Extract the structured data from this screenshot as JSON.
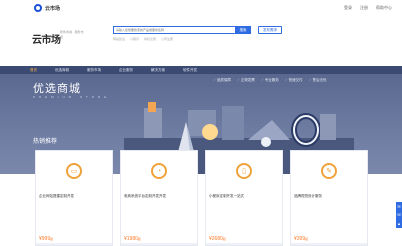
{
  "topbar": {
    "brand": "云市场",
    "links": [
      "登录",
      "注册",
      "帮助中心"
    ]
  },
  "header": {
    "logo": "云市场",
    "logo_sub": "软件商城 · 服务市场",
    "search_placeholder": "请输入您想要搜索的产品或服务名称",
    "search_button": "搜索",
    "publish_button": "发布需求",
    "hot_links": [
      "网站建设",
      "小程序",
      "商标注册",
      "公司注册"
    ]
  },
  "nav": {
    "items": [
      "首页",
      "优选商城",
      "服务市场",
      "企业服务",
      "解决方案",
      "软件开发"
    ],
    "active_index": 0
  },
  "banner": {
    "title": "优选商城",
    "subtitle": "PREMIUM STORE",
    "services": [
      "品质保障",
      "正规发票",
      "专业服务",
      "快速交付",
      "售后无忧"
    ],
    "section_title": "热销推荐"
  },
  "cards": [
    {
      "title": "企业网站搭建定制开发",
      "price": "¥999",
      "price_unit": "起",
      "icon": "monitor-icon"
    },
    {
      "title": "电商系统平台定制开发开发",
      "price": "¥1980",
      "price_unit": "起",
      "icon": "cart-icon"
    },
    {
      "title": "小程序定制开发一站式",
      "price": "¥2680",
      "price_unit": "起",
      "icon": "phone-icon"
    },
    {
      "title": "品牌视觉设计服务",
      "price": "¥399",
      "price_unit": "起",
      "icon": "brush-icon"
    }
  ],
  "side": {
    "icons": [
      "chat-icon",
      "phone-icon",
      "top-icon"
    ]
  },
  "colors": {
    "brand_blue": "#2f6be2",
    "nav_bg": "#3a4a72",
    "banner_bg": "#6f7da3",
    "accent_orange": "#ff7a2a"
  }
}
